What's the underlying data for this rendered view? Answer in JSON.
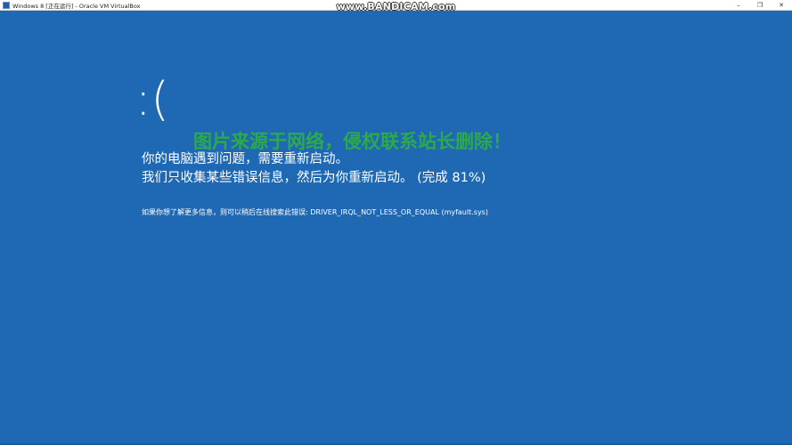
{
  "window": {
    "title": "Windows 8 [正在运行] - Oracle VM VirtualBox",
    "controls": {
      "minimize": "–",
      "restore": "❐",
      "close": "✕"
    }
  },
  "overlay": {
    "recorder_watermark": "www.BANDICAM.com",
    "copyright_watermark": "图片来源于网络，侵权联系站长删除！"
  },
  "bsod": {
    "sad_face": ":(",
    "line1": "你的电脑遇到问题，需要重新启动。",
    "line2": "我们只收集某些错误信息，然后为你重新启动。 (完成 81%)",
    "progress_percent": 81,
    "info_line": "如果你想了解更多信息，则可以稍后在线搜索此错误: DRIVER_IRQL_NOT_LESS_OR_EQUAL (myfault.sys)",
    "background_color": "#1f68b3"
  }
}
